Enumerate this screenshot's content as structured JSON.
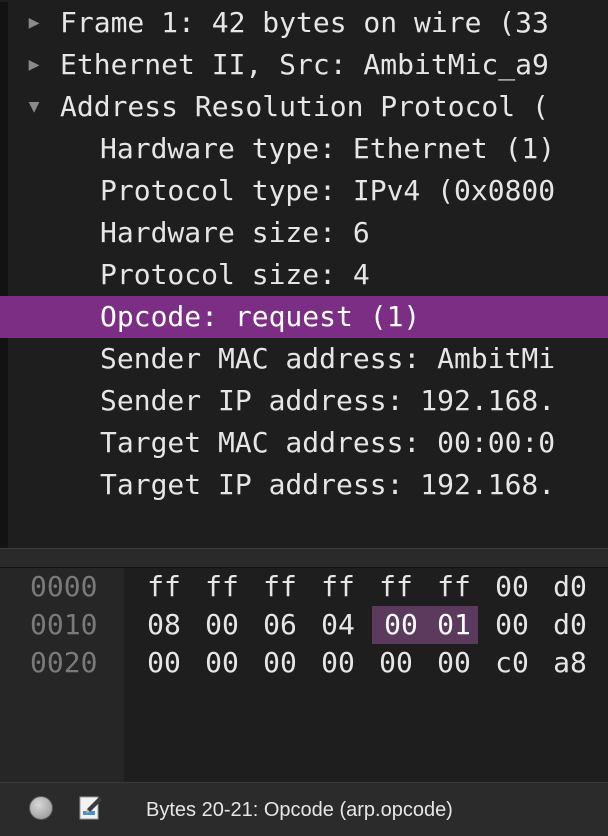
{
  "packet_details": {
    "rows": [
      {
        "text": "Frame 1: 42 bytes on wire (33",
        "caret": "▶"
      },
      {
        "text": "Ethernet II, Src: AmbitMic_a9",
        "caret": "▶"
      },
      {
        "text": "Address Resolution Protocol (",
        "caret": "▼"
      },
      {
        "text": "Hardware type: Ethernet (1)"
      },
      {
        "text": "Protocol type: IPv4 (0x0800"
      },
      {
        "text": "Hardware size: 6"
      },
      {
        "text": "Protocol size: 4"
      },
      {
        "text": "Opcode: request (1)"
      },
      {
        "text": "Sender MAC address: AmbitMi"
      },
      {
        "text": "Sender IP address: 192.168."
      },
      {
        "text": "Target MAC address: 00:00:0"
      },
      {
        "text": "Target IP address: 192.168."
      }
    ],
    "selected_index": 7
  },
  "bytes_pane": {
    "rows": [
      {
        "offset": "0000",
        "bytes": [
          "ff",
          "ff",
          "ff",
          "ff",
          "ff",
          "ff",
          "00",
          "d0"
        ]
      },
      {
        "offset": "0010",
        "bytes": [
          "08",
          "00",
          "06",
          "04",
          "00",
          "01",
          "00",
          "d0"
        ]
      },
      {
        "offset": "0020",
        "bytes": [
          "00",
          "00",
          "00",
          "00",
          "00",
          "00",
          "c0",
          "a8"
        ]
      }
    ],
    "highlight": {
      "row": 1,
      "bytes": [
        4,
        5
      ]
    }
  },
  "status_bar": {
    "text": "Bytes 20-21: Opcode (arp.opcode)",
    "icons": [
      "capture-status-icon",
      "packet-comment-icon"
    ]
  },
  "colors": {
    "background": "#1e1e1e",
    "selection": "#7b2e84",
    "byte_highlight": "#5b3a5e",
    "offset_text": "#7a7a7a"
  }
}
